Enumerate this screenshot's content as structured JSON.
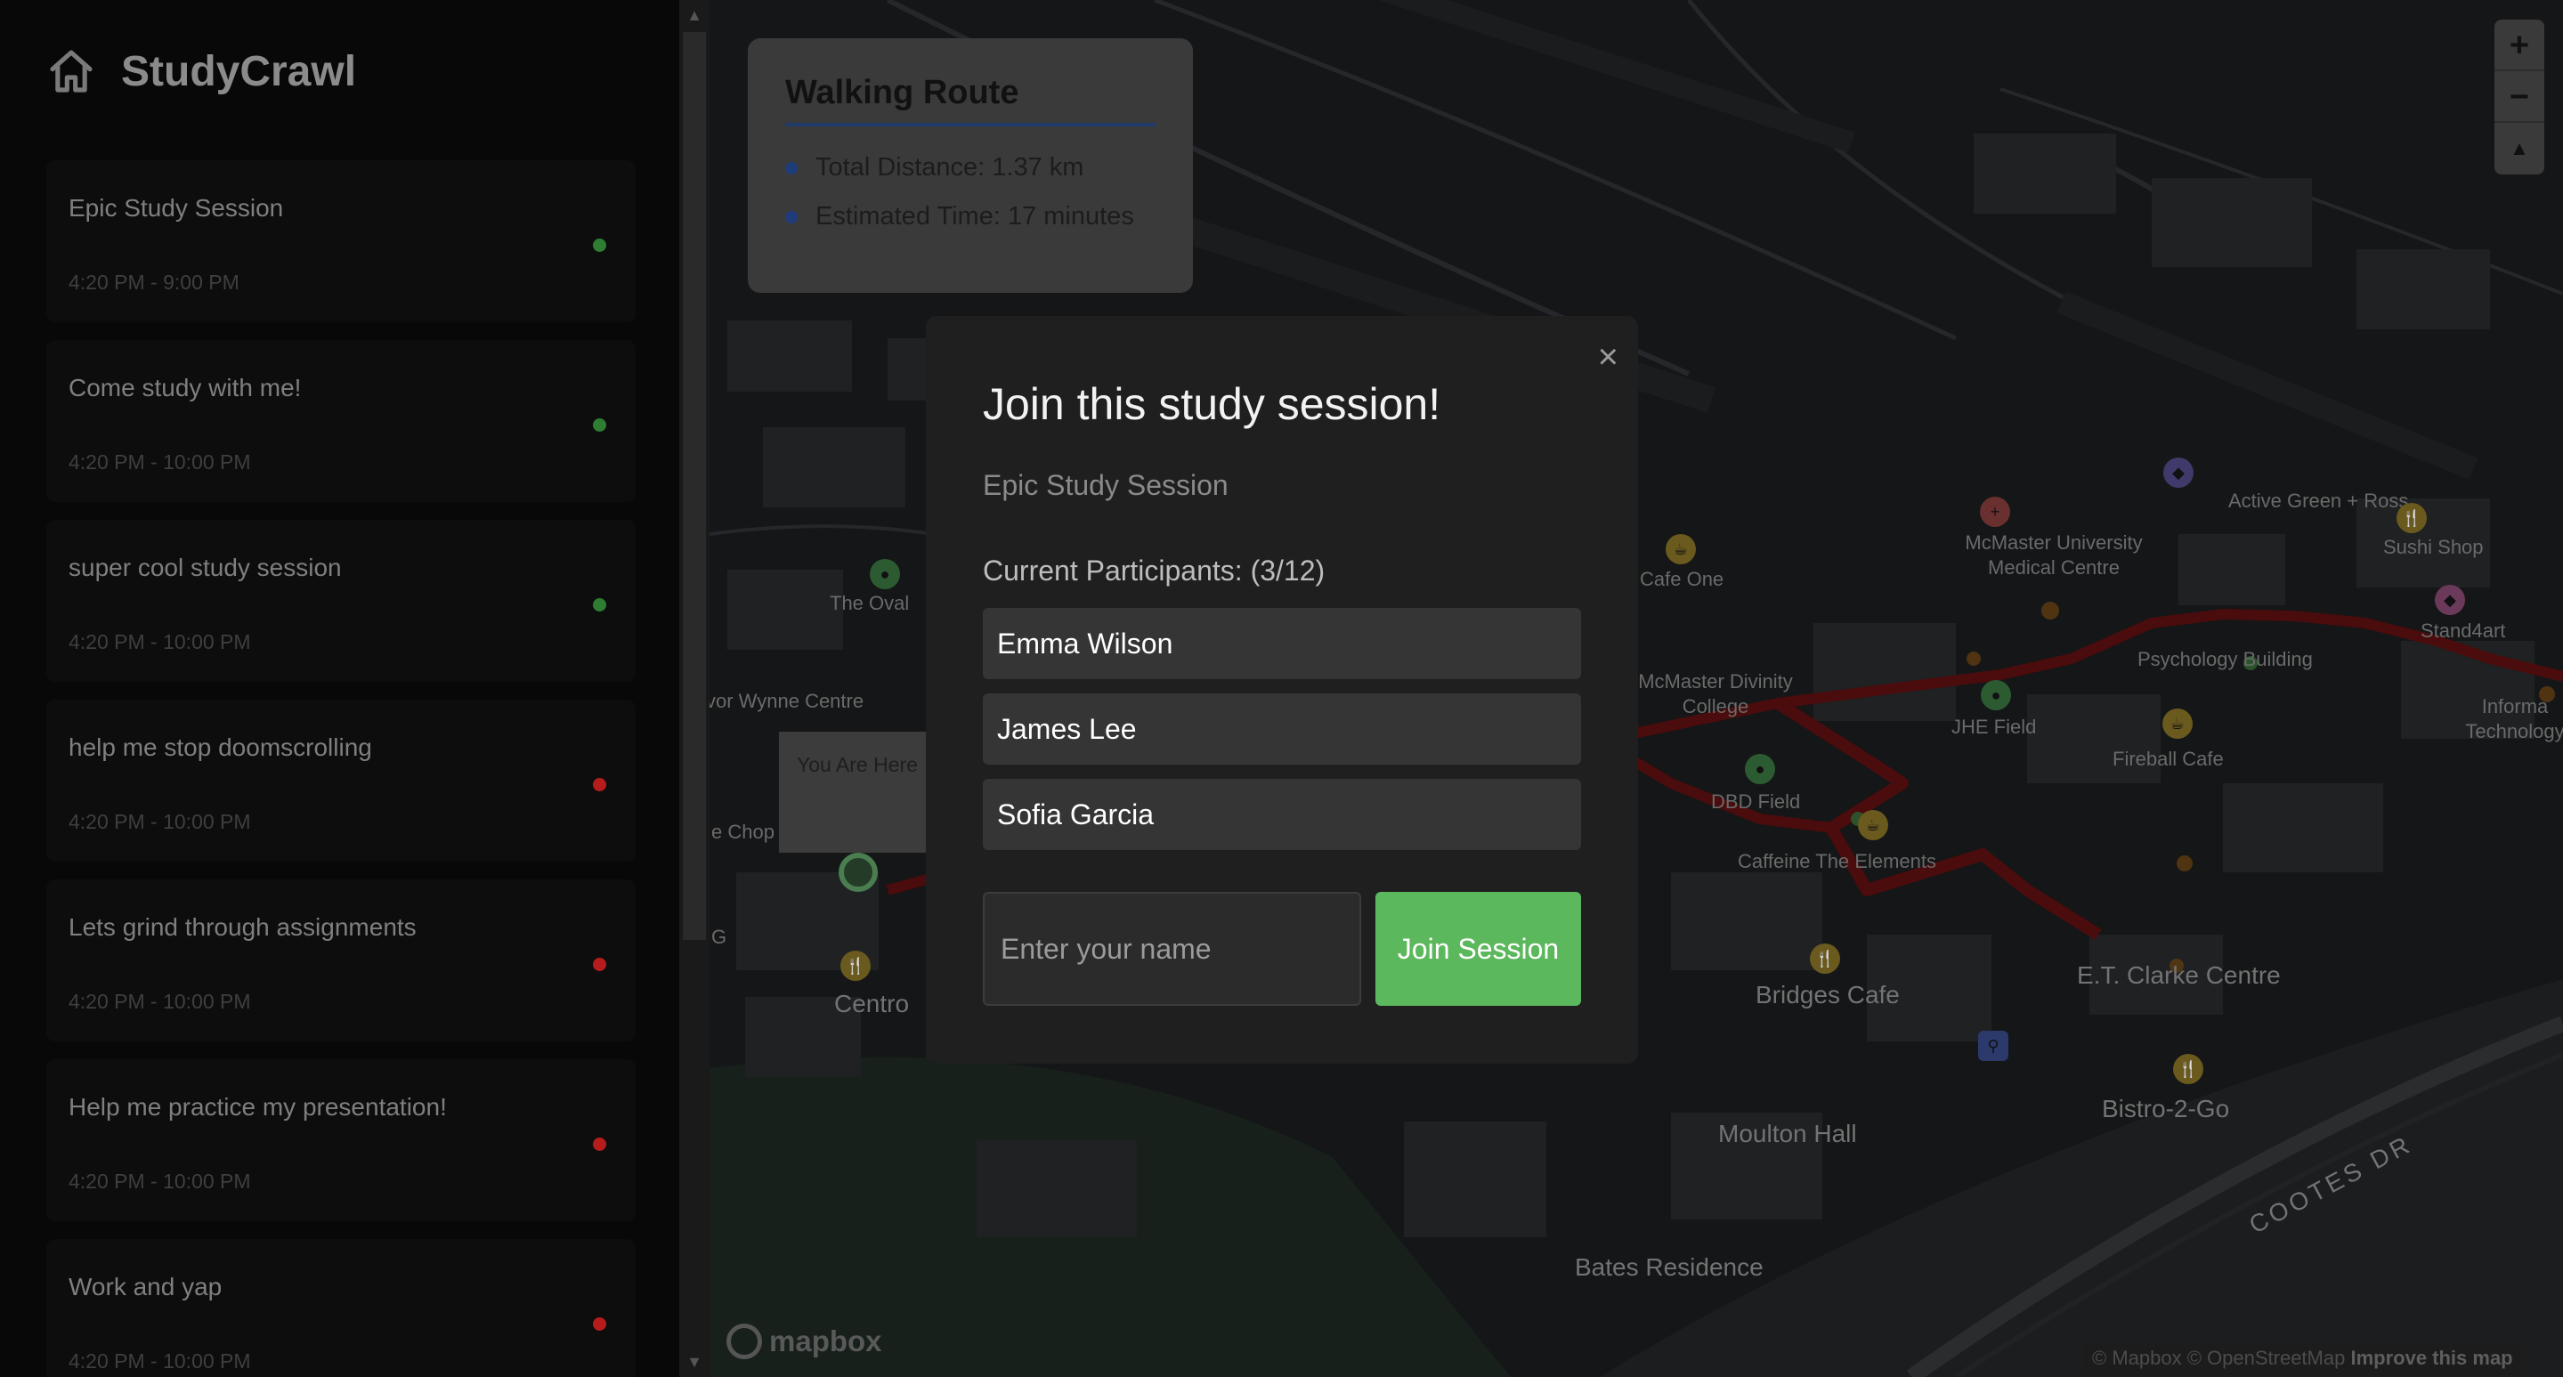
{
  "app": {
    "title": "StudyCrawl"
  },
  "sidebar": {
    "sessions": [
      {
        "name": "Epic Study Session",
        "time": "4:20 PM - 9:00 PM",
        "status_color": "#2e7d32"
      },
      {
        "name": "Come study with me!",
        "time": "4:20 PM - 10:00 PM",
        "status_color": "#2e7d32"
      },
      {
        "name": "super cool study session",
        "time": "4:20 PM - 10:00 PM",
        "status_color": "#2e7d32"
      },
      {
        "name": "help me stop doomscrolling",
        "time": "4:20 PM - 10:00 PM",
        "status_color": "#b71c1c"
      },
      {
        "name": "Lets grind through assignments",
        "time": "4:20 PM - 10:00 PM",
        "status_color": "#b71c1c"
      },
      {
        "name": "Help me practice my presentation!",
        "time": "4:20 PM - 10:00 PM",
        "status_color": "#b71c1c"
      },
      {
        "name": "Work and yap",
        "time": "4:20 PM - 10:00 PM",
        "status_color": "#b71c1c"
      }
    ]
  },
  "route": {
    "title": "Walking Route",
    "distance": "Total Distance: 1.37 km",
    "time": "Estimated Time: 17 minutes"
  },
  "you_are_here": "You Are Here",
  "modal": {
    "close_symbol": "×",
    "title": "Join this study session!",
    "session_name": "Epic Study Session",
    "participants_label": "Current Participants: (3/12)",
    "participants": [
      "Emma Wilson",
      "James Lee",
      "Sofia Garcia"
    ],
    "name_placeholder": "Enter your name",
    "join_label": "Join Session"
  },
  "map": {
    "labels": {
      "the_oval": "The Oval",
      "wynne_centre": "vor Wynne Centre",
      "e_chop": "e Chop",
      "g": "G",
      "centro": "Centro",
      "cafe_one": "Cafe One",
      "mcmaster_divinity": "McMaster Divinity College",
      "mcmaster_medical": "McMaster University Medical Centre",
      "active_green": "Active Green + Ross",
      "sushi_shop": "Sushi Shop",
      "stand4art": "Stand4art",
      "psychology": "Psychology Building",
      "informa": "Informa Technology",
      "jhe": "JHE Field",
      "fireball": "Fireball Cafe",
      "dbd": "DBD Field",
      "caffeine": "Caffeine The Elements",
      "bridges": "Bridges Cafe",
      "et_clarke": "E.T. Clarke Centre",
      "bistro": "Bistro-2-Go",
      "moulton": "Moulton Hall",
      "bates": "Bates Residence",
      "cootes": "COOTES DR"
    },
    "zoom_in": "+",
    "zoom_out": "−",
    "compass": "▲",
    "logo": "mapbox",
    "attribution_prefix": "© Mapbox © OpenStreetMap",
    "attribution_link": "Improve this map"
  }
}
